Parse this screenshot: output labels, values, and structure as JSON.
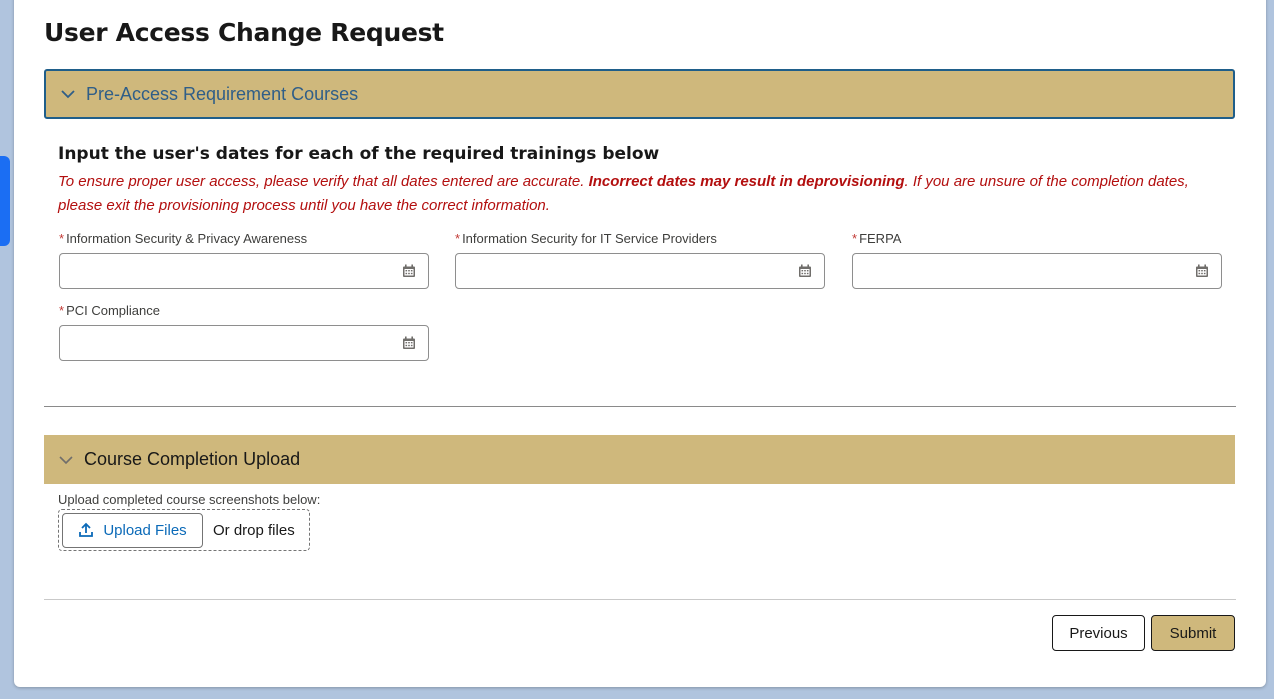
{
  "page": {
    "title": "User Access Change Request"
  },
  "sections": {
    "pre_access": {
      "label": "Pre-Access Requirement Courses",
      "expanded": true
    },
    "upload": {
      "label": "Course Completion Upload",
      "expanded": true
    }
  },
  "instructions": {
    "heading": "Input the user's dates for each of the required trainings below",
    "warning_part1": "To ensure proper user access, please verify that all dates entered are accurate. ",
    "warning_bold": "Incorrect dates may result in deprovisioning",
    "warning_part2": ". If you are unsure of the completion dates, please exit the provisioning process until you have the correct information."
  },
  "fields": [
    {
      "label": "Information Security & Privacy Awareness",
      "required": true,
      "value": "",
      "icon": "calendar-icon"
    },
    {
      "label": "Information Security for IT Service Providers",
      "required": true,
      "value": "",
      "icon": "calendar-icon"
    },
    {
      "label": "FERPA",
      "required": true,
      "value": "",
      "icon": "calendar-icon"
    },
    {
      "label": "PCI Compliance",
      "required": true,
      "value": "",
      "icon": "calendar-icon"
    }
  ],
  "upload": {
    "label": "Upload completed course screenshots below:",
    "button_label": "Upload Files",
    "drop_text": "Or drop files",
    "icon": "upload-icon"
  },
  "footer": {
    "previous_label": "Previous",
    "submit_label": "Submit"
  },
  "colors": {
    "accent_gold": "#cfb87c",
    "focus_border": "#1f5e8a",
    "warning_red": "#b30f0f",
    "link_blue": "#0b6ab8",
    "required_red": "#c23934"
  }
}
